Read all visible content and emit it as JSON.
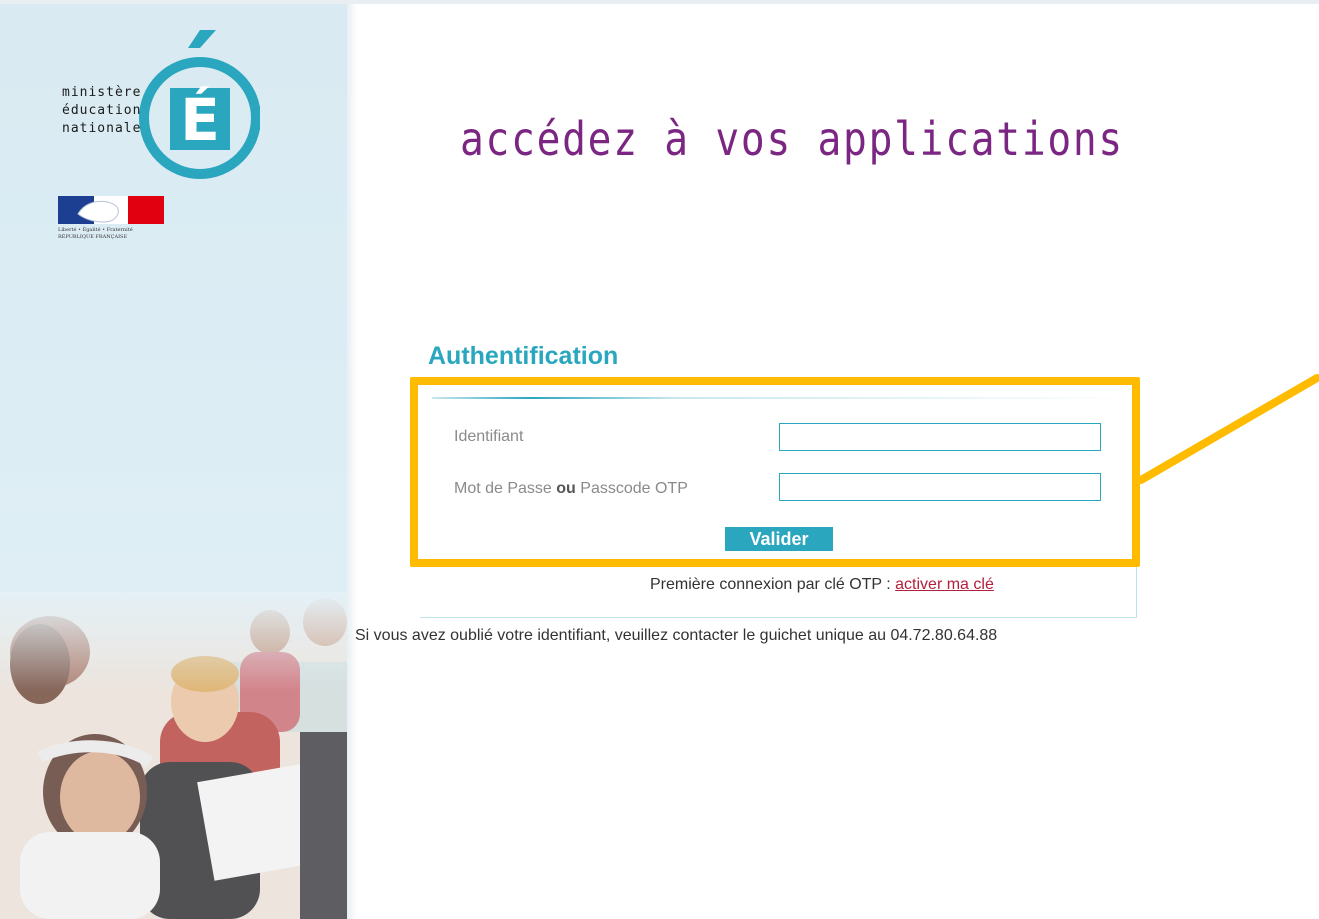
{
  "logo": {
    "lines": [
      "ministère",
      "éducation",
      "nationale"
    ],
    "letter": "É"
  },
  "republic": {
    "motto": "Liberté • Égalité • Fraternité",
    "name": "RÉPUBLIQUE FRANÇAISE"
  },
  "headline": "accédez à vos applications",
  "auth": {
    "title": "Authentification",
    "identifier_label": "Identifiant",
    "identifier_value": "",
    "password_label_part1": "Mot de Passe ",
    "password_label_or": "ou",
    "password_label_part2": " Passcode OTP",
    "password_value": "",
    "submit_label": "Valider"
  },
  "otp": {
    "text": "Première connexion par clé OTP : ",
    "link": "activer ma clé"
  },
  "help_text": "Si vous avez oublié votre identifiant, veuillez contacter le guichet unique au 04.72.80.64.88",
  "colors": {
    "accent": "#2aa7bf",
    "headline": "#7b2682",
    "highlight": "#ffbb00",
    "link": "#b1203c",
    "sidebar": "#dcedf4"
  }
}
